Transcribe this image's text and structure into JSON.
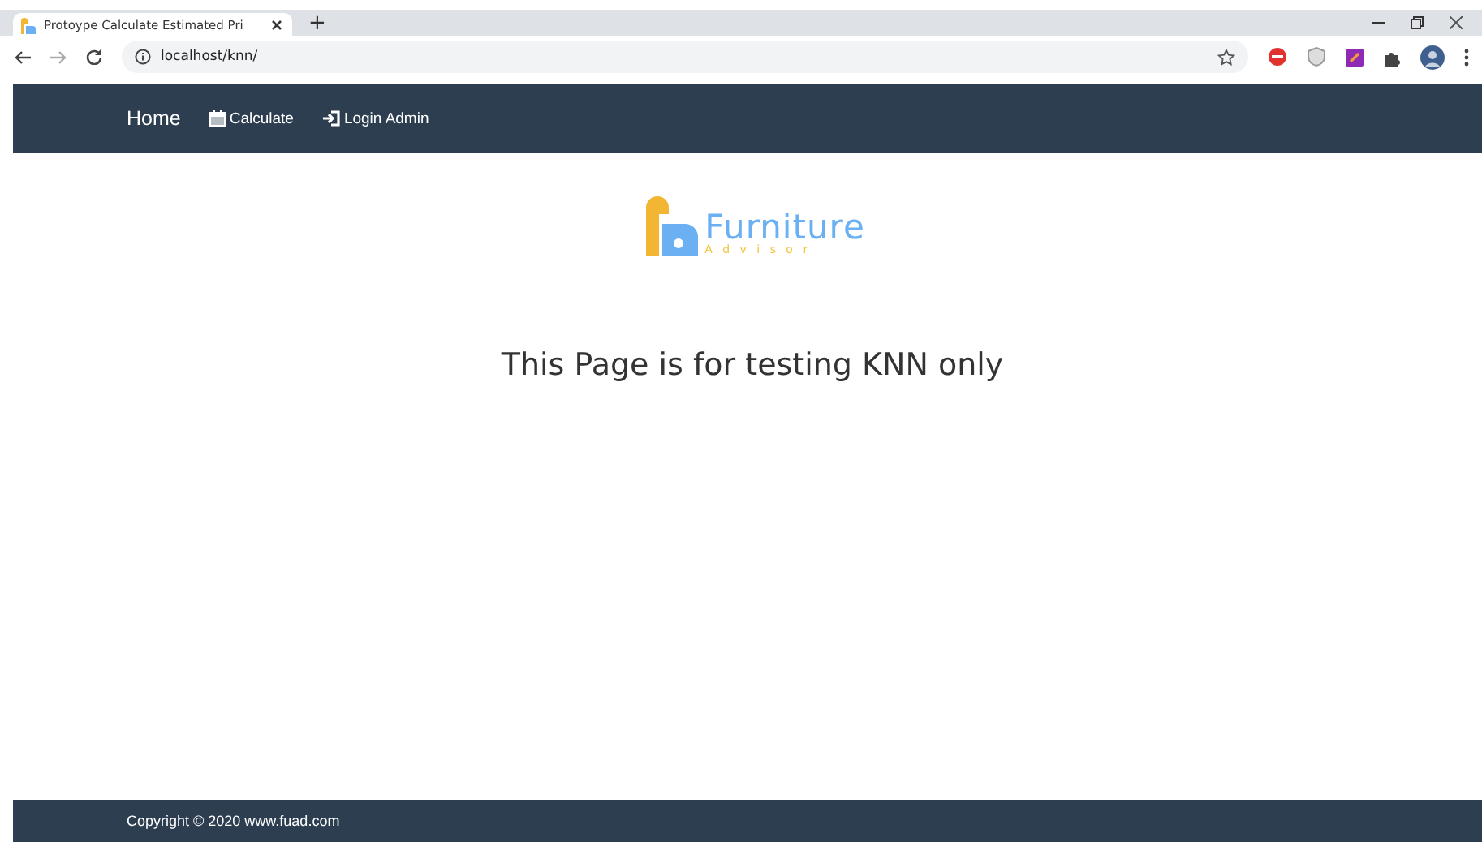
{
  "browser": {
    "tab": {
      "title": "Protoype Calculate Estimated Pri",
      "selected": true
    },
    "new_tab": "+",
    "address": "localhost/knn/"
  },
  "navbar": {
    "items": [
      {
        "label": "Home",
        "kind": "brand"
      },
      {
        "label": "Calculate",
        "kind": "calendar"
      },
      {
        "label": "Login Admin",
        "kind": "login"
      }
    ]
  },
  "logo": {
    "name": "Furniture",
    "tagline": "A d v i s o r"
  },
  "heading": "This Page is for testing KNN only",
  "footer": {
    "text": "Copyright © 2020 www.fuad.com"
  }
}
